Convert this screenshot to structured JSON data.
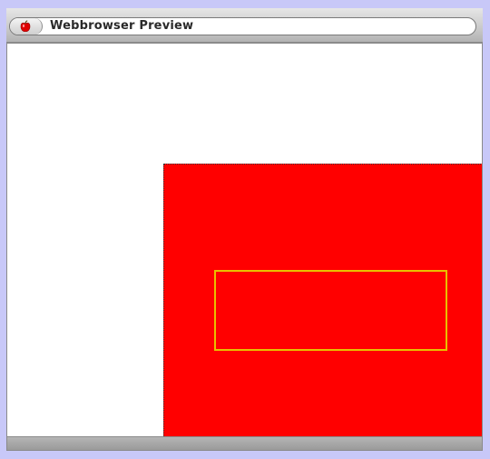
{
  "window": {
    "title": "Webbrowser Preview",
    "apple_icon": "apple-icon"
  },
  "content": {
    "red_box_color": "#ff0000",
    "yellow_rect_color": "#e8c000",
    "background_color": "#ffffff"
  },
  "colors": {
    "desktop_background": "#c8c8f8",
    "title_text": "#2a2a2a"
  }
}
